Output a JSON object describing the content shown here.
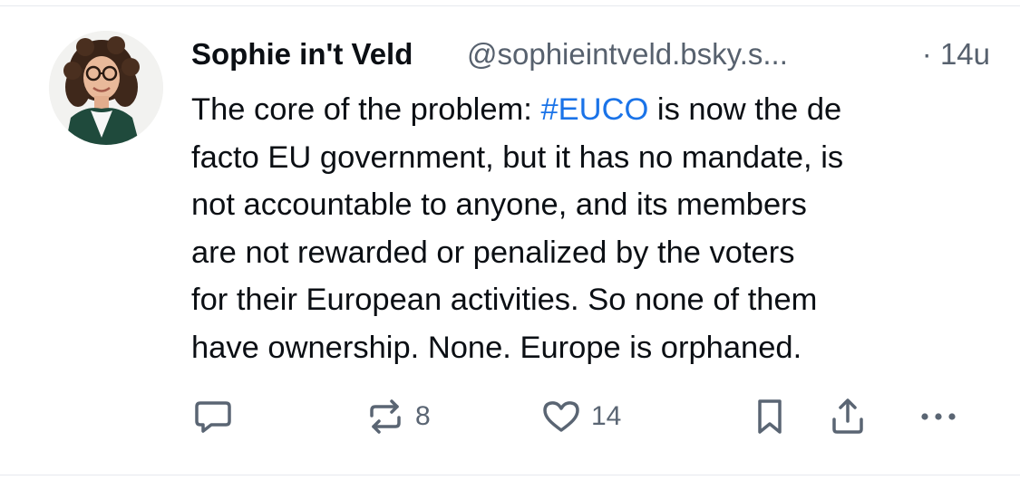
{
  "post": {
    "author": {
      "display_name": "Sophie in't Veld",
      "handle": "@sophieintveld.bsky.s...",
      "avatar_icon": "profile-photo"
    },
    "time": "· 14u",
    "text_lines": [
      [
        "The core of the problem: ",
        "#EUCO",
        " is now the de"
      ],
      "facto EU government, but it has no mandate, is",
      "not accountable to anyone, and its members",
      "are not rewarded or penalized by the voters",
      "for their European activities. So none of them",
      "have ownership. None. Europe is orphaned."
    ],
    "hashtag_color": "#1a73e8",
    "actions": {
      "reply": {
        "icon": "reply-icon",
        "count": ""
      },
      "repost": {
        "icon": "repost-icon",
        "count": "8"
      },
      "like": {
        "icon": "heart-icon",
        "count": "14"
      },
      "bookmark": {
        "icon": "bookmark-icon"
      },
      "share": {
        "icon": "share-icon"
      },
      "more": {
        "icon": "more-icon"
      }
    }
  }
}
